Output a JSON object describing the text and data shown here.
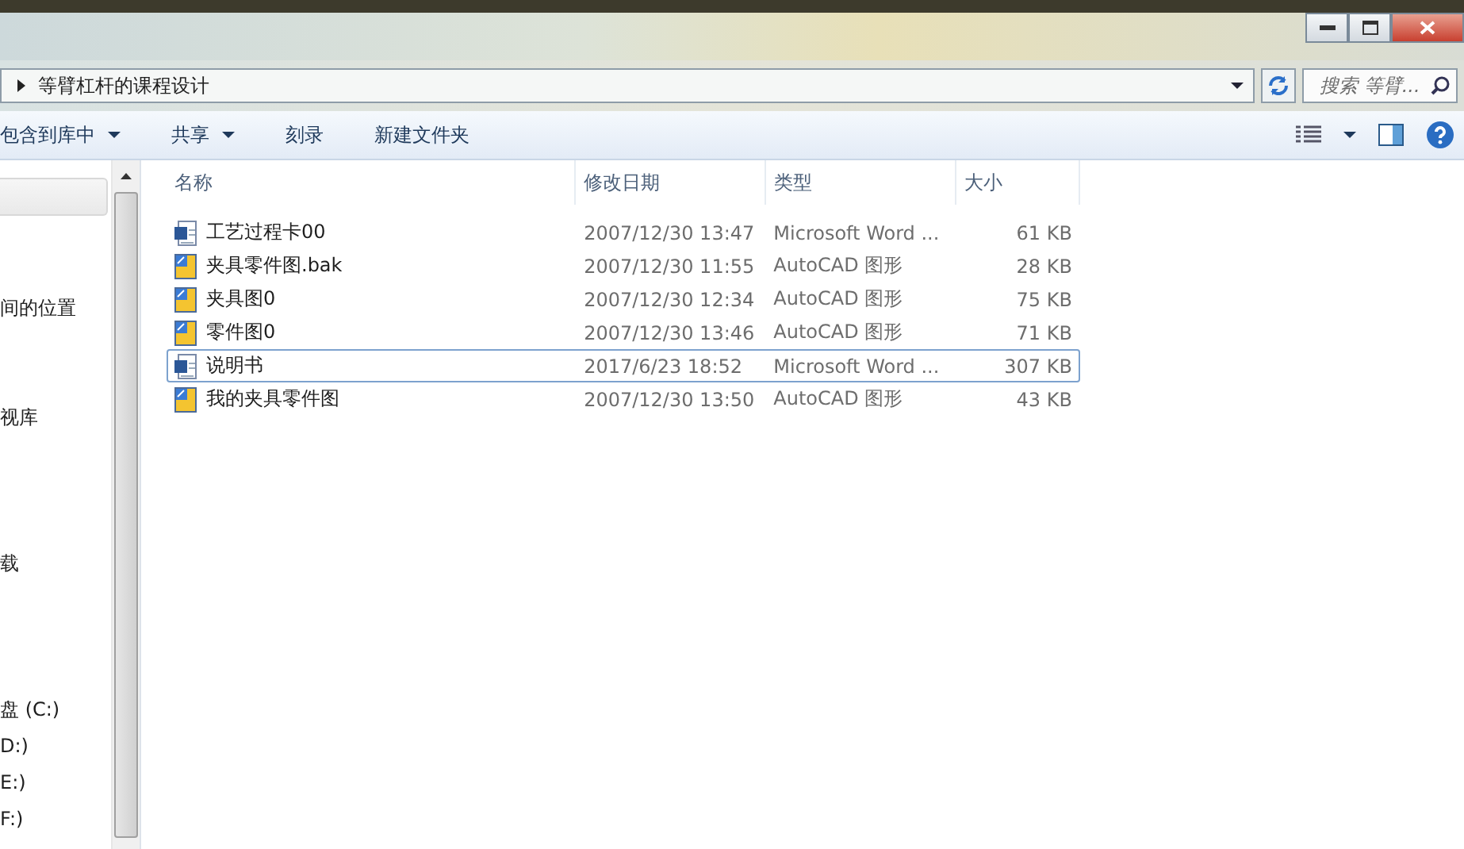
{
  "address": {
    "path": "等臂杠杆的课程设计"
  },
  "search": {
    "placeholder": "搜索 等臂..."
  },
  "toolbar": {
    "items": [
      "包含到库中",
      "共享",
      "刻录",
      "新建文件夹"
    ]
  },
  "sidebar": {
    "items": [
      {
        "selected": true
      },
      {
        "label": "间的位置",
        "selected": false
      },
      {
        "label": "视库",
        "selected": false
      },
      {
        "label": "载",
        "selected": false
      },
      {
        "label": "盘 (C:)",
        "selected": false
      },
      {
        "label": "D:)",
        "selected": false
      },
      {
        "label": "E:)",
        "selected": false
      },
      {
        "label": "F:)",
        "selected": false
      }
    ]
  },
  "table": {
    "columns": [
      "名称",
      "修改日期",
      "类型",
      "大小"
    ],
    "rows": [
      {
        "kind": "word",
        "name": "工艺过程卡00",
        "date": "2007/12/30 13:47",
        "type": "Microsoft Word ...",
        "size": "61 KB",
        "selected": false
      },
      {
        "kind": "cad",
        "name": "夹具零件图.bak",
        "date": "2007/12/30 11:55",
        "type": "AutoCAD 图形",
        "size": "28 KB",
        "selected": false
      },
      {
        "kind": "cad",
        "name": "夹具图0",
        "date": "2007/12/30 12:34",
        "type": "AutoCAD 图形",
        "size": "75 KB",
        "selected": false
      },
      {
        "kind": "cad",
        "name": "零件图0",
        "date": "2007/12/30 13:46",
        "type": "AutoCAD 图形",
        "size": "71 KB",
        "selected": false
      },
      {
        "kind": "word",
        "name": "说明书",
        "date": "2017/6/23 18:52",
        "type": "Microsoft Word ...",
        "size": "307 KB",
        "selected": true
      },
      {
        "kind": "cad",
        "name": "我的夹具零件图",
        "date": "2007/12/30 13:50",
        "type": "AutoCAD 图形",
        "size": "43 KB",
        "selected": false
      }
    ]
  }
}
